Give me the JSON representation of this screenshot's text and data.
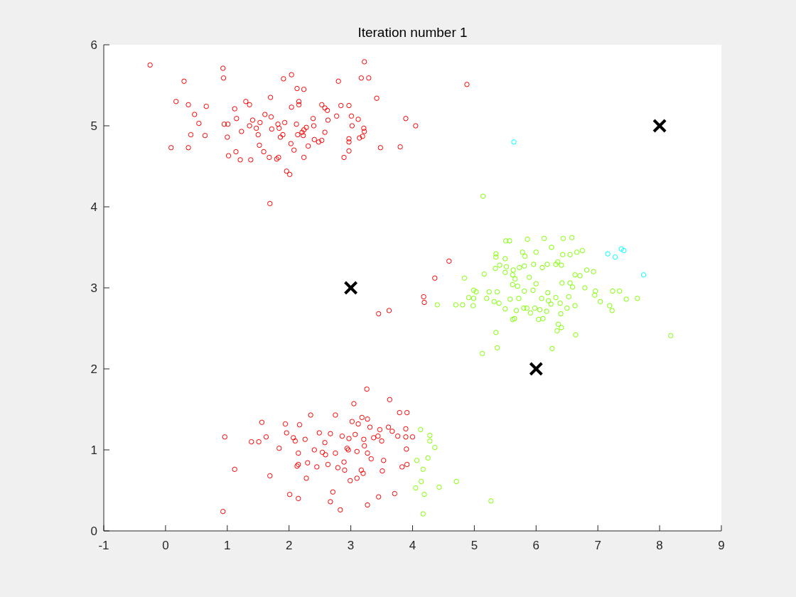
{
  "figure": {
    "chart_data": {
      "type": "scatter",
      "title": "Iteration number 1",
      "xlim": [
        -1,
        9
      ],
      "ylim": [
        0,
        6
      ],
      "xticks": [
        -1,
        0,
        1,
        2,
        3,
        4,
        5,
        6,
        7,
        8,
        9
      ],
      "yticks": [
        0,
        1,
        2,
        3,
        4,
        5,
        6
      ],
      "series": [
        {
          "color": "#ff0000",
          "x": [
            -0.25,
            0.93,
            0.94,
            0.3,
            0.17,
            0.37,
            0.66,
            0.47,
            0.54,
            0.95,
            1.01,
            1.12,
            1.3,
            1.36,
            1.61,
            1.7,
            1.91,
            2.04,
            2.13,
            2.24,
            2.16,
            2.16,
            2.04,
            2.53,
            2.58,
            2.62,
            2.8,
            3.22,
            3.17,
            3.29,
            3.42,
            2.84,
            2.97,
            3.01,
            3.12,
            3.21,
            3.22,
            3.02,
            2.97,
            2.97,
            3.14,
            3.19,
            2.77,
            2.63,
            2.39,
            2.4,
            2.28,
            2.24,
            2.21,
            2.14,
            2.12,
            1.93,
            1.82,
            1.84,
            1.9,
            1.86,
            1.71,
            1.72,
            1.53,
            1.5,
            1.47,
            1.41,
            1.36,
            1.23,
            1.15,
            1.0,
            1.02,
            1.14,
            1.21,
            1.38,
            1.52,
            1.59,
            1.68,
            1.8,
            1.83,
            1.96,
            2.01,
            2.03,
            2.08,
            2.23,
            2.24,
            2.31,
            2.41,
            2.48,
            2.53,
            2.58,
            2.89,
            2.97,
            3.48,
            3.89,
            4.05,
            3.8,
            4.88,
            1.69,
            0.09,
            0.37,
            0.41,
            0.64,
            4.59,
            4.36,
            4.18,
            4.19,
            3.62,
            3.45,
            3.26,
            3.63,
            3.05,
            2.35,
            2.75,
            1.56,
            1.94,
            2.17,
            3.18,
            3.27,
            3.02,
            3.12,
            3.31,
            3.47,
            3.79,
            3.91,
            3.89,
            3.61,
            3.67,
            1.63,
            1.96,
            2.07,
            2.1,
            2.26,
            2.49,
            2.67,
            2.58,
            2.86,
            2.97,
            3.07,
            3.21,
            3.37,
            3.5,
            3.44,
            3.76,
            3.89,
            4.0,
            1.39,
            1.51,
            0.96,
            1.84,
            2.15,
            2.41,
            2.54,
            2.59,
            2.75,
            2.94,
            2.96,
            3.1,
            3.27,
            3.22,
            3.33,
            3.53,
            3.9,
            2.89,
            2.63,
            2.3,
            2.13,
            2.15,
            2.45,
            2.79,
            2.9,
            3.17,
            3.2,
            3.51,
            3.83,
            3.91,
            1.12,
            1.69,
            2.28,
            2.01,
            2.15,
            2.71,
            2.67,
            2.83,
            3.1,
            2.99,
            3.45,
            3.71,
            3.27,
            0.93
          ],
          "values": [
            5.75,
            5.71,
            5.59,
            5.55,
            5.3,
            5.26,
            5.24,
            5.14,
            5.03,
            5.02,
            5.02,
            5.21,
            5.3,
            5.26,
            5.14,
            5.35,
            5.58,
            5.63,
            5.46,
            5.45,
            5.3,
            5.26,
            5.23,
            5.26,
            5.22,
            5.19,
            5.55,
            5.79,
            5.59,
            5.59,
            5.34,
            5.25,
            5.25,
            5.12,
            5.08,
            4.97,
            4.93,
            5.0,
            4.84,
            4.8,
            4.85,
            4.87,
            5.12,
            5.07,
            5.09,
            5.0,
            4.98,
            4.95,
            4.92,
            4.89,
            5.02,
            5.04,
            5.02,
            4.97,
            4.89,
            4.86,
            5.11,
            4.96,
            5.04,
            4.89,
            4.97,
            5.07,
            5.0,
            4.93,
            5.09,
            4.86,
            4.63,
            4.68,
            4.58,
            4.58,
            4.76,
            4.68,
            4.61,
            4.59,
            4.61,
            4.44,
            4.4,
            4.78,
            4.7,
            4.88,
            4.61,
            4.75,
            4.83,
            4.8,
            4.82,
            4.92,
            4.61,
            4.69,
            4.73,
            5.09,
            5.0,
            4.74,
            5.51,
            4.04,
            4.73,
            4.73,
            4.89,
            4.88,
            3.33,
            3.12,
            2.89,
            2.82,
            2.72,
            2.68,
            1.75,
            1.62,
            1.57,
            1.43,
            1.43,
            1.34,
            1.32,
            1.31,
            1.4,
            1.38,
            1.35,
            1.32,
            1.28,
            1.25,
            1.46,
            1.46,
            1.26,
            1.28,
            1.23,
            1.16,
            1.21,
            1.15,
            1.11,
            1.13,
            1.21,
            1.2,
            1.09,
            1.17,
            1.14,
            1.19,
            1.13,
            1.15,
            1.11,
            1.17,
            1.17,
            1.16,
            1.16,
            1.1,
            1.1,
            1.16,
            1.02,
            0.96,
            1.0,
            0.97,
            0.94,
            0.96,
            1.02,
            1.0,
            0.98,
            0.96,
            1.05,
            0.89,
            0.87,
            1.01,
            0.85,
            0.82,
            0.84,
            0.8,
            0.82,
            0.79,
            0.78,
            0.75,
            0.75,
            0.71,
            0.74,
            0.79,
            0.82,
            0.76,
            0.68,
            0.65,
            0.45,
            0.4,
            0.48,
            0.36,
            0.26,
            0.65,
            0.62,
            0.42,
            0.46,
            0.32,
            0.24
          ]
        },
        {
          "color": "#80ff00",
          "x": [
            5.14,
            5.51,
            5.57,
            5.86,
            6.13,
            6.44,
            6.58,
            5.35,
            5.35,
            5.78,
            5.82,
            6.0,
            6.25,
            6.43,
            6.55,
            6.66,
            6.75,
            6.82,
            6.93,
            6.63,
            6.71,
            6.35,
            6.41,
            6.32,
            6.18,
            6.1,
            5.96,
            5.81,
            5.73,
            5.63,
            5.5,
            5.5,
            5.62,
            5.66,
            5.89,
            5.81,
            5.62,
            5.7,
            6.0,
            5.95,
            6.19,
            6.42,
            6.55,
            6.59,
            6.79,
            6.95,
            7.24,
            7.35,
            6.96,
            7.04,
            6.53,
            6.32,
            6.2,
            6.24,
            6.17,
            6.06,
            5.98,
            5.91,
            5.85,
            5.68,
            5.5,
            5.4,
            5.32,
            5.2,
            4.99,
            5.03,
            4.99,
            4.91,
            5.37,
            5.58,
            6.04,
            6.11,
            6.09,
            6.39,
            6.4,
            6.5,
            6.63,
            7.19,
            7.23,
            7.64,
            7.46,
            6.36,
            6.64,
            8.18,
            5.35,
            5.37,
            5.13,
            6.26,
            4.4,
            4.7,
            4.81,
            4.98,
            5.72,
            5.8,
            5.16,
            5.24,
            4.84,
            5.34,
            5.52,
            5.41,
            6.34,
            6.41,
            5.62,
            5.65,
            4.13,
            4.28,
            4.28,
            4.36,
            4.25,
            4.07,
            4.17,
            4.14,
            4.05,
            4.19,
            4.43,
            4.71,
            4.17,
            5.27
          ],
          "values": [
            4.13,
            3.58,
            3.58,
            3.6,
            3.61,
            3.61,
            3.62,
            3.42,
            3.38,
            3.44,
            3.39,
            3.44,
            3.5,
            3.41,
            3.41,
            3.44,
            3.46,
            3.22,
            3.2,
            3.16,
            3.15,
            3.32,
            3.28,
            3.29,
            3.29,
            3.25,
            3.29,
            3.27,
            3.25,
            3.22,
            3.19,
            3.36,
            3.16,
            3.11,
            3.13,
            2.96,
            3.04,
            3.02,
            3.05,
            2.97,
            2.94,
            3.06,
            3.06,
            3.01,
            3.0,
            2.91,
            2.96,
            2.96,
            2.96,
            2.83,
            2.89,
            2.88,
            2.84,
            2.8,
            2.71,
            2.73,
            2.75,
            2.69,
            2.75,
            2.72,
            2.74,
            2.81,
            2.83,
            2.87,
            2.87,
            2.95,
            2.97,
            2.88,
            2.95,
            2.86,
            2.61,
            2.62,
            2.87,
            2.81,
            2.68,
            2.75,
            2.78,
            2.78,
            2.72,
            2.87,
            2.86,
            2.55,
            2.42,
            2.41,
            2.45,
            2.26,
            2.19,
            2.25,
            2.79,
            2.79,
            2.79,
            2.78,
            2.87,
            2.75,
            3.17,
            2.95,
            3.12,
            3.24,
            3.26,
            3.28,
            2.47,
            2.51,
            2.61,
            2.62,
            1.25,
            1.18,
            1.11,
            1.03,
            0.9,
            0.87,
            0.76,
            0.61,
            0.53,
            0.45,
            0.54,
            0.61,
            0.21,
            0.37
          ]
        },
        {
          "color": "#00ffff",
          "x": [
            5.64,
            7.16,
            7.38,
            7.42,
            7.28,
            7.74
          ],
          "values": [
            4.8,
            3.42,
            3.48,
            3.46,
            3.38,
            3.16
          ]
        },
        {
          "color": "#000000",
          "x": [
            3,
            6,
            8
          ],
          "values": [
            3,
            2,
            5
          ]
        }
      ]
    }
  }
}
